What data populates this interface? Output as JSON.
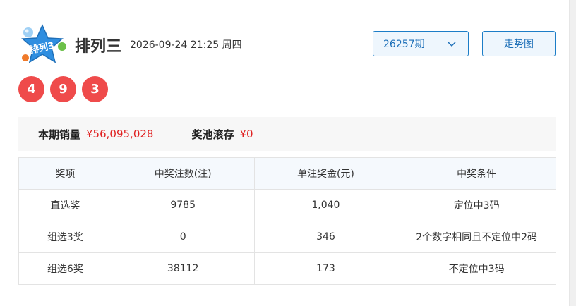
{
  "header": {
    "logo_text": "排列3",
    "title": "排列三",
    "datetime": "2026-09-24 21:25 周四",
    "period_selected": "26257期",
    "trend_label": "走势图"
  },
  "draw": {
    "numbers": [
      "4",
      "9",
      "3"
    ]
  },
  "sales": {
    "sales_label": "本期销量",
    "sales_value": "¥56,095,028",
    "pool_label": "奖池滚存",
    "pool_value": "¥0"
  },
  "prize_table": {
    "headers": [
      "奖项",
      "中奖注数(注)",
      "单注奖金(元)",
      "中奖条件"
    ],
    "rows": [
      [
        "直选奖",
        "9785",
        "1,040",
        "定位中3码"
      ],
      [
        "组选3奖",
        "0",
        "346",
        "2个数字相同且不定位中2码"
      ],
      [
        "组选6奖",
        "38112",
        "173",
        "不定位中3码"
      ]
    ]
  },
  "colors": {
    "ball_red": "#ef4b4b",
    "accent_blue": "#1c7dc7",
    "money_red": "#e02020"
  }
}
